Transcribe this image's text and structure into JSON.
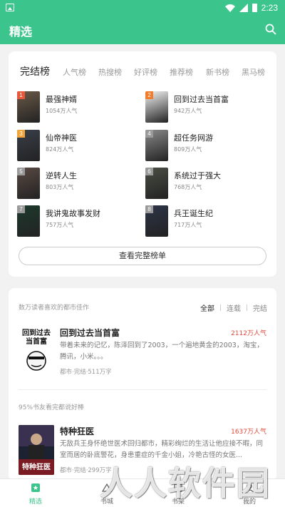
{
  "status_bar": {
    "time": "2:23"
  },
  "header": {
    "title": "精选"
  },
  "rank_tabs": [
    "完结榜",
    "人气榜",
    "热搜榜",
    "好评榜",
    "推荐榜",
    "新书榜",
    "黑马榜"
  ],
  "rank_list": [
    {
      "rank": "1",
      "title": "最强神婿",
      "popularity": "1054万人气",
      "cover_color": "#6b5a48",
      "badge_color": "#e8583c"
    },
    {
      "rank": "2",
      "title": "回到过去当首富",
      "popularity": "942万人气",
      "cover_color": "#f4f4f4",
      "badge_color": "#f07c2c"
    },
    {
      "rank": "3",
      "title": "仙帝神医",
      "popularity": "824万人气",
      "cover_color": "#3a3f4a",
      "badge_color": "#f2a53a"
    },
    {
      "rank": "4",
      "title": "超任务网游",
      "popularity": "809万人气",
      "cover_color": "#8a8a8a",
      "badge_color": "#9a9a9a"
    },
    {
      "rank": "5",
      "title": "逆转人生",
      "popularity": "803万人气",
      "cover_color": "#5a4a44",
      "badge_color": "#9a9a9a"
    },
    {
      "rank": "6",
      "title": "系统过于强大",
      "popularity": "768万人气",
      "cover_color": "#4a4f44",
      "badge_color": "#9a9a9a"
    },
    {
      "rank": "7",
      "title": "我讲鬼故事发财",
      "popularity": "757万人气",
      "cover_color": "#1d3a2e",
      "badge_color": "#9a9a9a"
    },
    {
      "rank": "8",
      "title": "兵王诞生纪",
      "popularity": "717万人气",
      "cover_color": "#2e3548",
      "badge_color": "#9a9a9a"
    }
  ],
  "view_all_label": "查看完整榜单",
  "city_section": {
    "subtitle": "数万读者喜欢的都市佳作",
    "filters": [
      "全部",
      "连载",
      "完结"
    ],
    "books": [
      {
        "title": "回到过去当首富",
        "popularity": "2112万人气",
        "description": "带着未来的记忆，陈泽回到了2003，一个遍地黄金的2003，淘宝，腾讯，小米。。。",
        "meta": "都市·完结·511万字",
        "cover_text": "回到过去当首富"
      }
    ]
  },
  "read_section": {
    "subtitle": "95%书友看完都说好棒",
    "books": [
      {
        "title": "特种狂医",
        "popularity": "1637万人气",
        "description": "无敌兵王身怀绝世医术回归都市，精彩绚烂的生活让他应接不暇，同室而居的卧底警花，身患重症的千金小姐，冷艳古怪的女医...",
        "meta": "都市·完结·299万字",
        "cover_text": "特种狂医"
      }
    ]
  },
  "bottom_nav": [
    "精选",
    "书城",
    "书架",
    "我的"
  ],
  "watermark_text": "人人软件园",
  "colors": {
    "accent": "#3cc48d",
    "popularity_red": "#e04a3b"
  }
}
